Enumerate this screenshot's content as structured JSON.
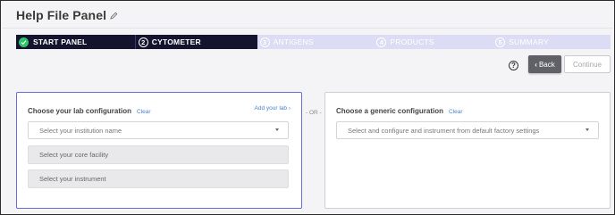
{
  "header": {
    "title": "Help File Panel"
  },
  "stepper": {
    "steps": [
      {
        "number": "",
        "label": "START PANEL",
        "state": "done"
      },
      {
        "number": "2",
        "label": "CYTOMETER",
        "state": "active"
      },
      {
        "number": "3",
        "label": "ANTIGENS",
        "state": "upcoming"
      },
      {
        "number": "4",
        "label": "PRODUCTS",
        "state": "upcoming"
      },
      {
        "number": "5",
        "label": "SUMMARY",
        "state": "upcoming"
      }
    ]
  },
  "controls": {
    "help_label": "?",
    "back_label": "Back",
    "continue_label": "Continue"
  },
  "lab_config": {
    "heading": "Choose your lab configuration",
    "clear_label": "Clear",
    "add_lab_label": "Add your lab",
    "institution_placeholder": "Select your institution name",
    "core_facility_placeholder": "Select your core facility",
    "instrument_placeholder": "Select your instrument"
  },
  "separator": {
    "or_label": "- OR -"
  },
  "generic_config": {
    "heading": "Choose a generic configuration",
    "clear_label": "Clear",
    "factory_placeholder": "Select and configure and instrument from default factory settings"
  },
  "colors": {
    "stepper_active": "#14142f",
    "stepper_upcoming": "#dcdcf5",
    "check_green": "#2fc36b",
    "link_blue": "#4a7fd3",
    "panel_focus_border": "#6b6bd8"
  }
}
